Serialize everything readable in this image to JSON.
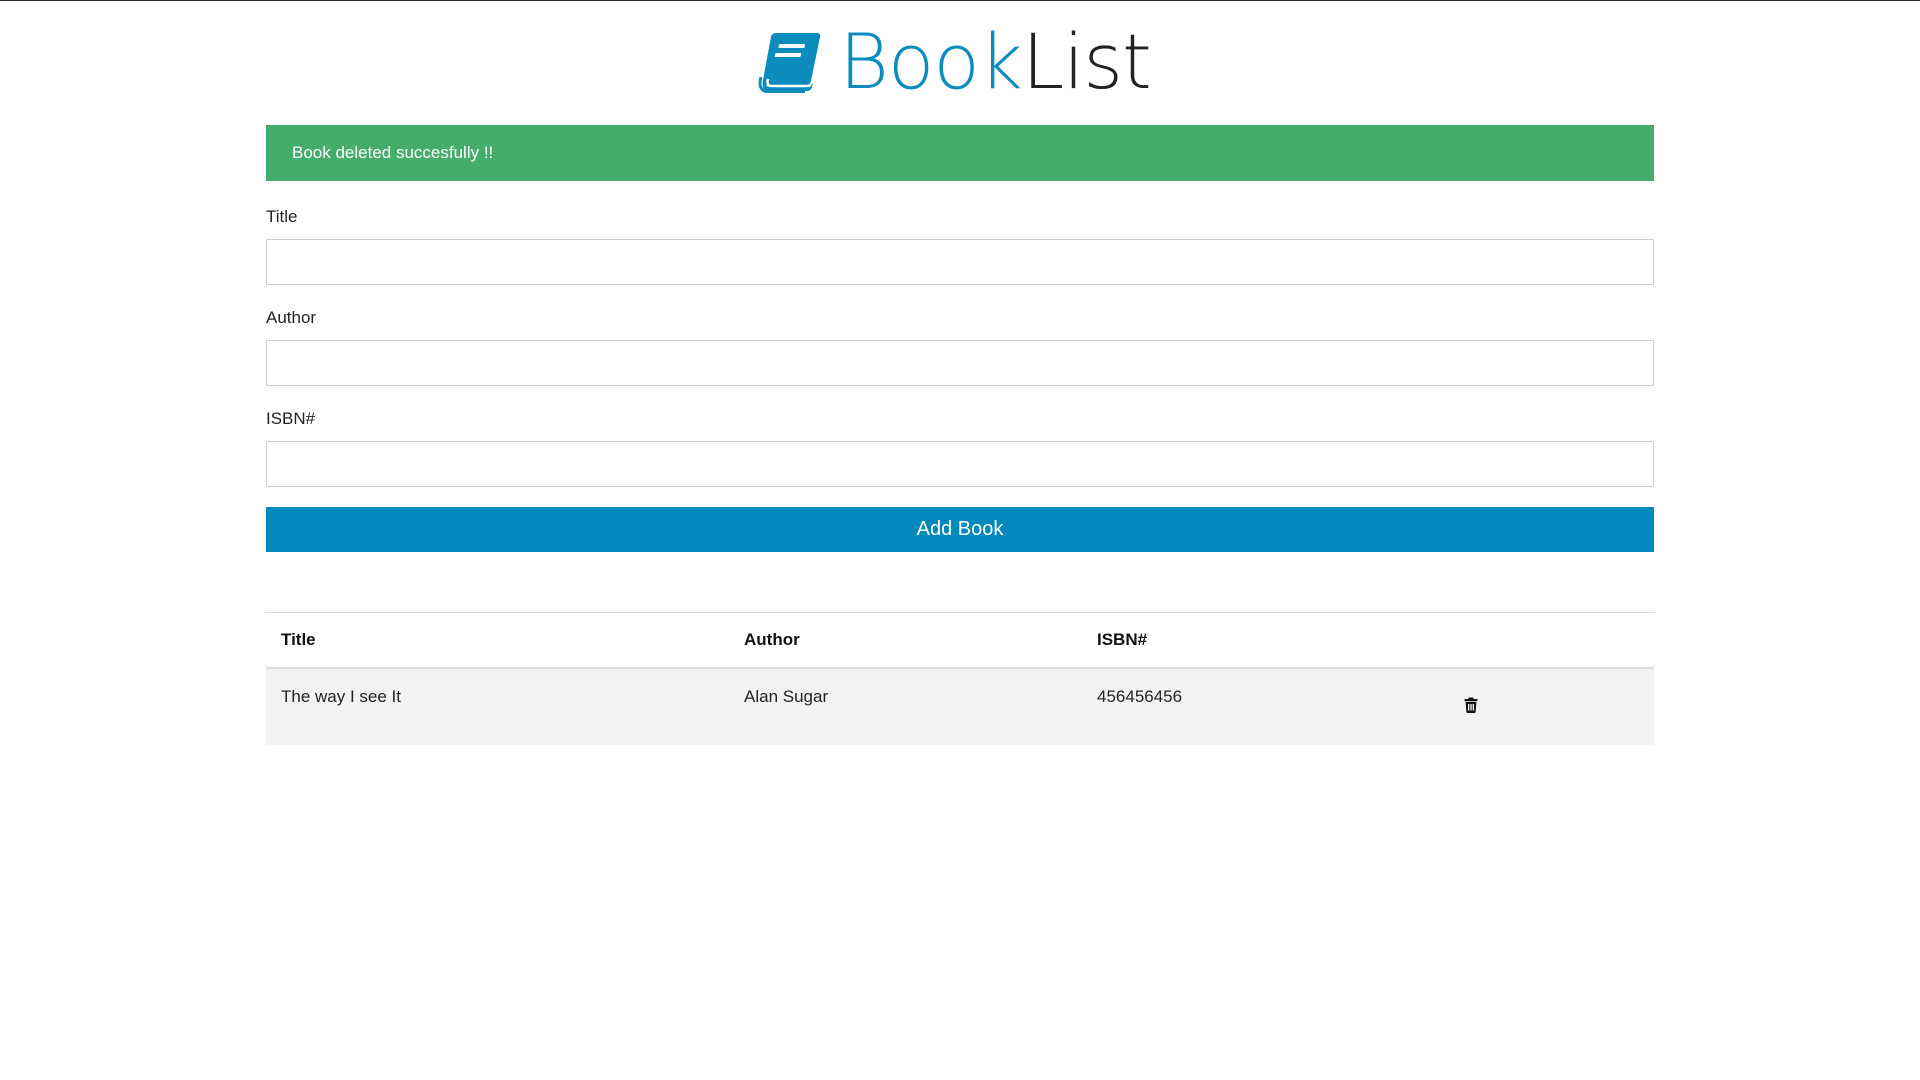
{
  "brand": {
    "title_part1": "Book",
    "title_part2": "List",
    "accent_color": "#0b8cbd",
    "icon": "book-icon"
  },
  "alert": {
    "message": "Book deleted succesfully !!",
    "color": "#44ad6c"
  },
  "form": {
    "title_label": "Title",
    "title_value": "",
    "author_label": "Author",
    "author_value": "",
    "isbn_label": "ISBN#",
    "isbn_value": "",
    "submit_label": "Add Book",
    "submit_color": "#0189bb"
  },
  "table": {
    "headers": [
      "Title",
      "Author",
      "ISBN#"
    ],
    "rows": [
      {
        "title": "The way I see It",
        "author": "Alan Sugar",
        "isbn": "456456456",
        "action_icon": "trash-icon"
      }
    ]
  }
}
